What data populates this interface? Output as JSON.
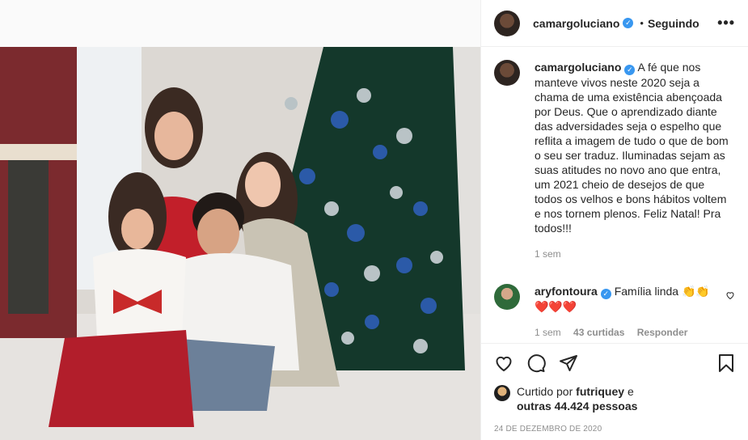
{
  "post": {
    "author": "camargoluciano",
    "dot": "•",
    "follow_status": "Seguindo",
    "more": "•••",
    "caption": "A fé que nos manteve vivos neste 2020 seja a chama de uma existência abençoada por Deus. Que o aprendizado diante das adversidades seja o espelho que reflita a imagem de tudo o que de bom o seu ser traduz. Iluminadas sejam as suas atitudes no novo ano que entra, um 2021 cheio de desejos de que todos os velhos e bons hábitos voltem e nos tornem plenos. Feliz Natal! Pra todos!!!",
    "caption_time": "1 sem",
    "date": "24 DE DEZEMBRO DE 2020"
  },
  "comment": {
    "author": "aryfontoura",
    "text": "Família linda 👏👏❤️❤️❤️",
    "time": "1 sem",
    "likes": "43 curtidas",
    "reply": "Responder"
  },
  "likes": {
    "prefix": "Curtido por",
    "user": "futriquey",
    "mid": "e",
    "others": "outras 44.424 pessoas"
  },
  "icons": {
    "verified": "verified-badge-icon",
    "like": "heart-icon",
    "comment": "comment-icon",
    "share": "share-icon",
    "save": "bookmark-icon",
    "more": "more-options-icon"
  },
  "colors": {
    "verified": "#3897f0",
    "muted": "#8e8e8e",
    "text": "#262626"
  }
}
